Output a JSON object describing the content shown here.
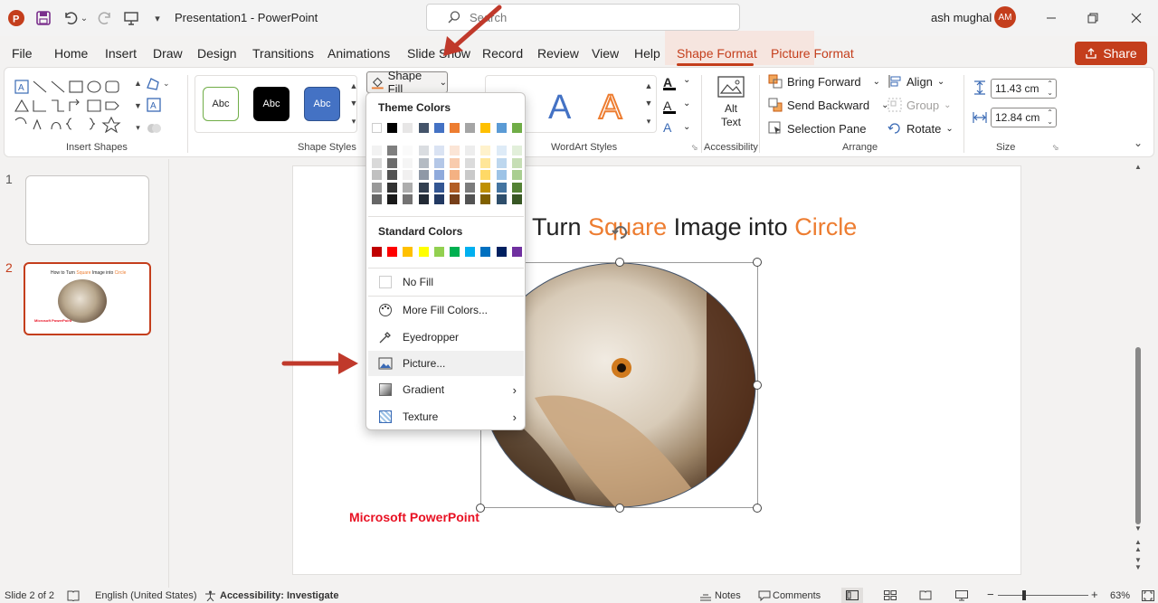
{
  "titlebar": {
    "doc_title": "Presentation1",
    "app_name": "PowerPoint",
    "separator": " - ",
    "search_placeholder": "Search",
    "user_name": "ash mughal",
    "user_initials": "AM",
    "avatar_color": "#c43e1c"
  },
  "tabs": [
    "File",
    "Home",
    "Insert",
    "Draw",
    "Design",
    "Transitions",
    "Animations",
    "Slide Show",
    "Record",
    "Review",
    "View",
    "Help",
    "Shape Format",
    "Picture Format"
  ],
  "active_tab": "Shape Format",
  "share_label": "Share",
  "ribbon": {
    "groups": {
      "insert_shapes": "Insert Shapes",
      "shape_styles": "Shape Styles",
      "wordart_styles": "WordArt Styles",
      "accessibility": "Accessibility",
      "arrange": "Arrange",
      "size": "Size"
    },
    "style_samples": [
      "Abc",
      "Abc",
      "Abc"
    ],
    "shape_fill_label": "Shape Fill",
    "alt_text": [
      "Alt",
      "Text"
    ],
    "arrange": {
      "bring_forward": "Bring Forward",
      "send_backward": "Send Backward",
      "selection_pane": "Selection Pane",
      "align": "Align",
      "group": "Group",
      "rotate": "Rotate"
    },
    "size": {
      "height": "11.43 cm",
      "width": "12.84 cm"
    }
  },
  "menu": {
    "theme_colors_label": "Theme Colors",
    "standard_colors_label": "Standard Colors",
    "no_fill": "No Fill",
    "more_colors": "More Fill Colors...",
    "eyedropper": "Eyedropper",
    "picture": "Picture...",
    "gradient": "Gradient",
    "texture": "Texture",
    "theme_top": [
      "#ffffff",
      "#000000",
      "#e7e6e6",
      "#44546a",
      "#4472c4",
      "#ed7d31",
      "#a5a5a5",
      "#ffc000",
      "#5b9bd5",
      "#70ad47"
    ],
    "standard": [
      "#c00000",
      "#ff0000",
      "#ffc000",
      "#ffff00",
      "#92d050",
      "#00b050",
      "#00b0f0",
      "#0070c0",
      "#002060",
      "#7030a0"
    ]
  },
  "slides": {
    "numbers": [
      "1",
      "2"
    ],
    "active": "2"
  },
  "slide": {
    "title_parts": [
      "How to Turn ",
      "Square",
      " Image into ",
      "Circle"
    ],
    "title_visible_prefix": "o Turn ",
    "accent_color": "#ed7d31",
    "footer_text": "Microsoft PowerPoint",
    "footer_color": "#e81123"
  },
  "status": {
    "slide_info": "Slide 2 of 2",
    "language": "English (United States)",
    "accessibility": "Accessibility: Investigate",
    "notes": "Notes",
    "comments": "Comments",
    "zoom": "63%"
  }
}
